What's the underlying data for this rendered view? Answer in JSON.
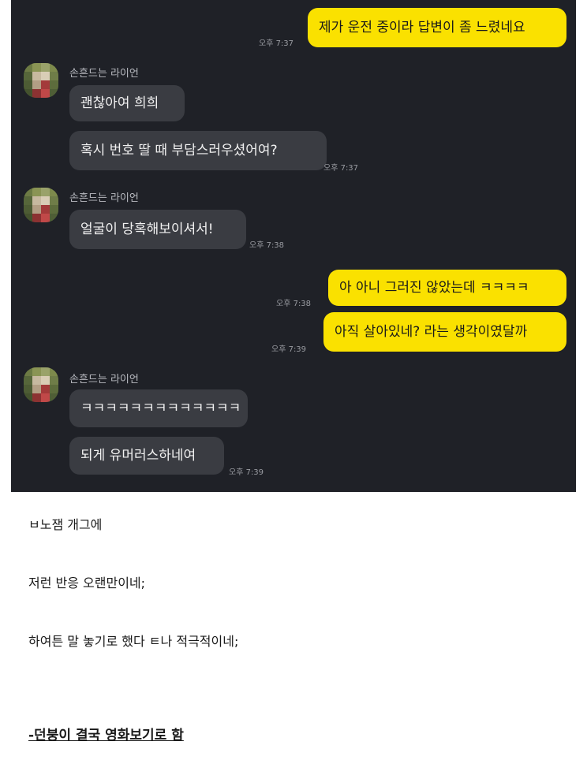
{
  "chat": {
    "messages_mine_1": {
      "text": "제가 운전 중이라 답변이 좀 느렸네요",
      "time": "오후 7:37"
    },
    "sender_name": "손흔드는 라이언",
    "group1": {
      "msg1": "괜찮아여 희희",
      "msg2": "혹시 번호 딸 때 부담스러우셨어여?",
      "time": "오후 7:37"
    },
    "group2": {
      "msg1": "얼굴이 당혹해보이셔서!",
      "time": "오후 7:38"
    },
    "mine2": {
      "text": "아 아니 그러진 않았는데 ㅋㅋㅋㅋ",
      "time": "오후 7:38"
    },
    "mine3": {
      "text": "아직 살아있네? 라는 생각이였달까",
      "time": "오후 7:39"
    },
    "group3": {
      "msg1": "ㅋㅋㅋㅋㅋㅋㅋㅋㅋㅋㅋㅋㅋ",
      "msg2": "되게 유머러스하네여",
      "time": "오후 7:39"
    }
  },
  "captions": {
    "line1": "ㅂ노잼 개그에",
    "line2": "저런 반응 오랜만이네;",
    "line3": "하여튼 말 놓기로 했다 ㅌ나 적극적이네;",
    "line4": "-던붕이 결국 영화보기로 함"
  },
  "colors": {
    "chat_bg": "#1f2127",
    "my_bubble": "#fae100",
    "their_bubble": "#3a3c42"
  }
}
